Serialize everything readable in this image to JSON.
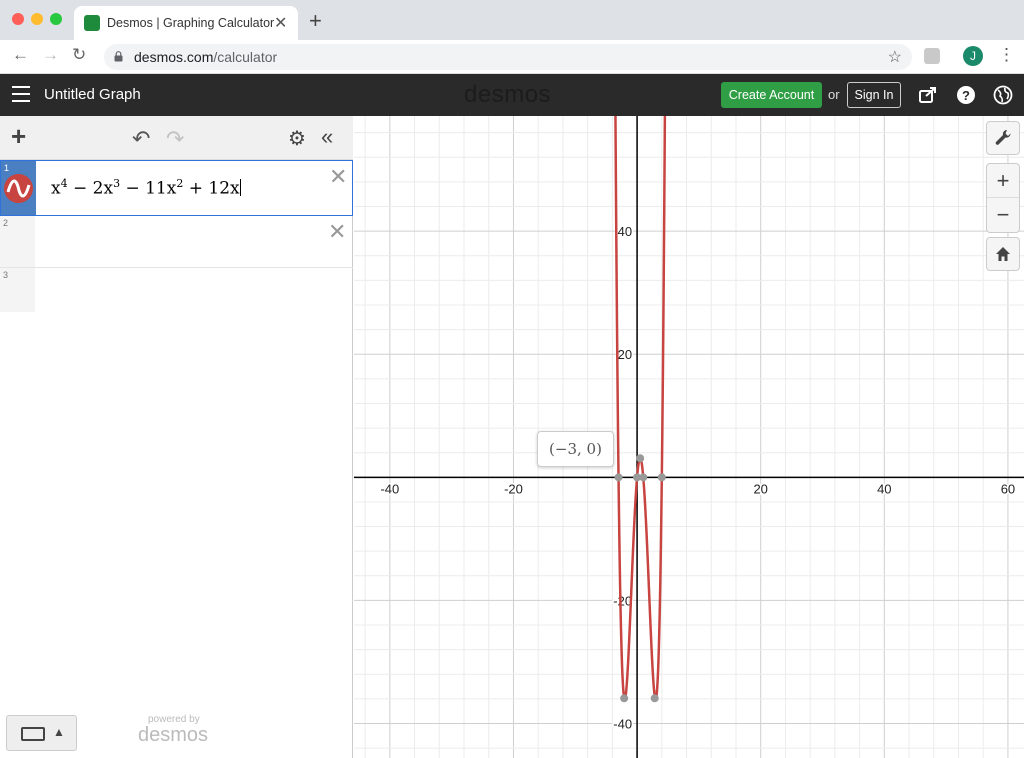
{
  "browser": {
    "tab_title": "Desmos | Graphing Calculator",
    "url_host": "desmos.com",
    "url_path": "/calculator",
    "profile_initial": "J"
  },
  "header": {
    "title": "Untitled Graph",
    "brand": "desmos",
    "create_account": "Create Account",
    "or": "or",
    "sign_in": "Sign In"
  },
  "expressions": [
    {
      "num": "1",
      "formula_parts": [
        "x",
        "4",
        " − 2x",
        "3",
        " − 11x",
        "2",
        " + 12x"
      ],
      "color": "#c74440"
    },
    {
      "num": "2"
    },
    {
      "num": "3"
    }
  ],
  "footer": {
    "powered_by": "powered by",
    "brand": "desmos"
  },
  "tooltip": "(−3, 0)",
  "colors": {
    "curve": "#c74440",
    "accent": "#2f9e44",
    "selection": "#2f72dc"
  },
  "chart_data": {
    "type": "line",
    "function": "x^4 - 2x^3 - 11x^2 + 12x",
    "xlim": [
      -45.8,
      62.6
    ],
    "ylim": [
      -45.6,
      58.7
    ],
    "xticks": [
      -40,
      -20,
      20,
      40,
      60
    ],
    "yticks": [
      -40,
      -20,
      20,
      40
    ],
    "x_tick_labels": [
      "-40",
      "-20",
      "20",
      "40",
      "60"
    ],
    "y_tick_labels": [
      "-40",
      "-20",
      "20",
      "40"
    ],
    "grid": true,
    "points": [
      {
        "x": -3,
        "y": 0
      },
      {
        "x": 0,
        "y": 0
      },
      {
        "x": 1,
        "y": 0
      },
      {
        "x": 4,
        "y": 0
      },
      {
        "x": 0.5,
        "y": 3.1
      },
      {
        "x": -2.09,
        "y": -35.9
      },
      {
        "x": 2.85,
        "y": -35.9
      }
    ]
  }
}
